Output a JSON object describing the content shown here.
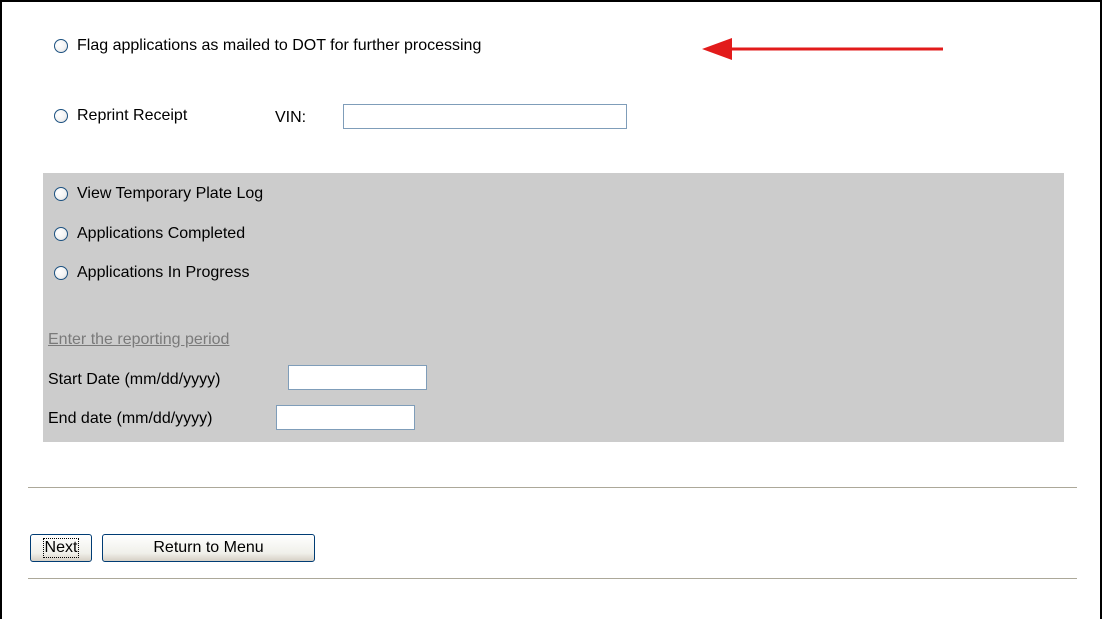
{
  "options": {
    "flag_label": "Flag applications as mailed to DOT for further processing",
    "reprint_label": "Reprint Receipt",
    "vin_label": "VIN:",
    "vin_value": "",
    "report_options": [
      {
        "label": "View Temporary Plate Log"
      },
      {
        "label": "Applications Completed"
      },
      {
        "label": "Applications In Progress"
      }
    ]
  },
  "reporting": {
    "link_text": "Enter the reporting period",
    "start_label": "Start Date (mm/dd/yyyy)",
    "start_value": "",
    "end_label": "End date (mm/dd/yyyy)",
    "end_value": ""
  },
  "buttons": {
    "next": "Next",
    "return_menu": "Return to Menu"
  },
  "colors": {
    "arrow": "#e21b1b",
    "panel": "#cccccc",
    "link": "#7a7a7a"
  },
  "icons": {
    "radio": "radio-button-icon",
    "arrow": "red-arrow-icon"
  }
}
